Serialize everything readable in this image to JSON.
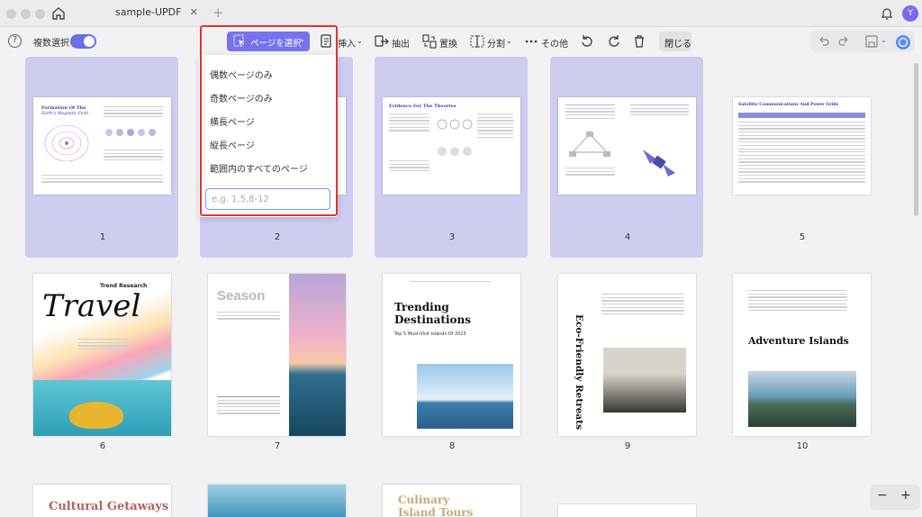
{
  "tab": {
    "title": "sample-UPDF",
    "close": "✕",
    "add": "+"
  },
  "user": {
    "initial": "Y"
  },
  "toolbar": {
    "help": "?",
    "multi_select_label": "複数選択",
    "select_pages_label": "ページを選択",
    "insert_label": "挿入",
    "extract_label": "抽出",
    "replace_label": "置換",
    "split_label": "分割",
    "more_label": "その他",
    "close_label": "閉じる"
  },
  "dropdown": {
    "items": [
      "偶数ページのみ",
      "奇数ページのみ",
      "横長ページ",
      "縦長ページ",
      "範囲内のすべてのページ"
    ],
    "range_placeholder": "e.g. 1,5,8-12"
  },
  "pages": [
    {
      "number": "1",
      "title": "Formation Of The",
      "subtitle": "Earth's Magnetic Field"
    },
    {
      "number": "2"
    },
    {
      "number": "3",
      "title": "Evidence For The Theories"
    },
    {
      "number": "4"
    },
    {
      "number": "5",
      "title": "Satellite Communications And Power Grids"
    },
    {
      "number": "6",
      "title": "Travel",
      "subtitle": "Trend Research"
    },
    {
      "number": "7",
      "title": "Season"
    },
    {
      "number": "8",
      "title": "Trending Destinations",
      "subtitle": "Top 5 Must-Visit Islands Of 2023"
    },
    {
      "number": "9",
      "title": "Eco-Friendly Retreats"
    },
    {
      "number": "10",
      "title": "Adventure Islands"
    },
    {
      "title": "Cultural Getaways"
    },
    {
      "title": "Culinary Island Tours"
    }
  ],
  "zoom": {
    "minus": "−",
    "plus": "+"
  },
  "colors": {
    "accent": "#7572ec",
    "selection": "#cdcdf0",
    "highlight": "#e5332a"
  }
}
